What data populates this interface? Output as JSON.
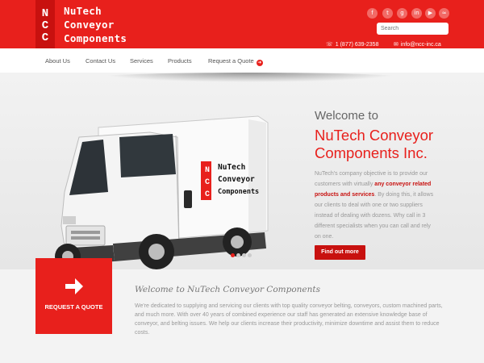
{
  "logo": {
    "letters": [
      "N",
      "C",
      "C"
    ],
    "lines": [
      "NuTech",
      "Conveyor",
      "Components"
    ]
  },
  "social_icons": [
    "facebook-icon",
    "twitter-icon",
    "google-plus-icon",
    "linkedin-icon",
    "youtube-icon",
    "rss-icon"
  ],
  "search": {
    "placeholder": "Search"
  },
  "contact": {
    "phone": "1 (877) 639-2358",
    "email": "info@ncc-inc.ca"
  },
  "nav": {
    "items": [
      "About Us",
      "Contact Us",
      "Services",
      "Products",
      "Request a Quote"
    ]
  },
  "slider": {
    "van_text": [
      "NuTech",
      "Conveyor",
      "Components"
    ],
    "van_letters": [
      "N",
      "C",
      "C"
    ],
    "welcome_small": "Welcome to",
    "welcome_big": "NuTech Conveyor Components Inc.",
    "para_1": "NuTech's company objective is to provide our customers with virtually ",
    "para_bold": "any conveyor related products and services",
    "para_2": ". By doing this, it allows our clients to deal with one or two suppliers instead of dealing with dozens. Why call in 3 different specialists when you can call and rely on one.",
    "button": "Find out more",
    "dots_count": 4,
    "active_dot": 0
  },
  "lower": {
    "quote_label": "REQUEST A QUOTE",
    "title": "Welcome to NuTech Conveyor Components",
    "paragraph": "We're dedicated to supplying and servicing our clients with top quality conveyor belting, conveyors, custom machined parts, and much more. With over 40 years of combined experience our staff has generated an extensive knowledge base of conveyor, and belting issues. We help our clients increase their productivity, minimize downtime and assist them to reduce costs."
  },
  "colors": {
    "brand_red": "#e8201c",
    "dark_red": "#c8110f"
  }
}
